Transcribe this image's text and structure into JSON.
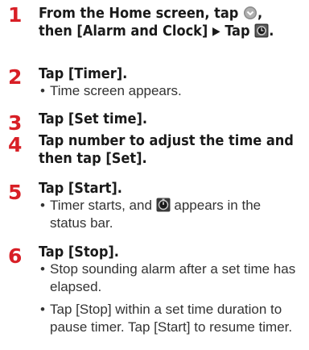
{
  "steps": [
    {
      "number": "1",
      "line1_a": "From the Home screen, tap",
      "line1_b": ",",
      "line2_a": "then [Alarm and Clock]",
      "arrow": "▶",
      "line2_b": "Tap",
      "line2_c": ".",
      "icons": [
        "menu-icon",
        "clock-app-icon"
      ]
    },
    {
      "number": "2",
      "title": "Tap [Timer].",
      "bullets": [
        "Time screen appears."
      ]
    },
    {
      "number": "3",
      "title": "Tap [Set time]."
    },
    {
      "number": "4",
      "title_line1": "Tap number to adjust the time and",
      "title_line2": "then tap [Set]."
    },
    {
      "number": "5",
      "title": "Tap [Start].",
      "bullet_a": "Timer starts, and",
      "bullet_b": "appears in the",
      "bullet_c": "status bar.",
      "icons": [
        "timer-status-icon"
      ]
    },
    {
      "number": "6",
      "title": "Tap [Stop].",
      "bullets": [
        "Stop sounding alarm after a set time has elapsed.",
        "Tap [Stop] within a set time duration to pause timer. Tap [Start] to resume timer."
      ]
    }
  ],
  "colors": {
    "step_number": "#d81f26",
    "text": "#1a1a1a"
  }
}
